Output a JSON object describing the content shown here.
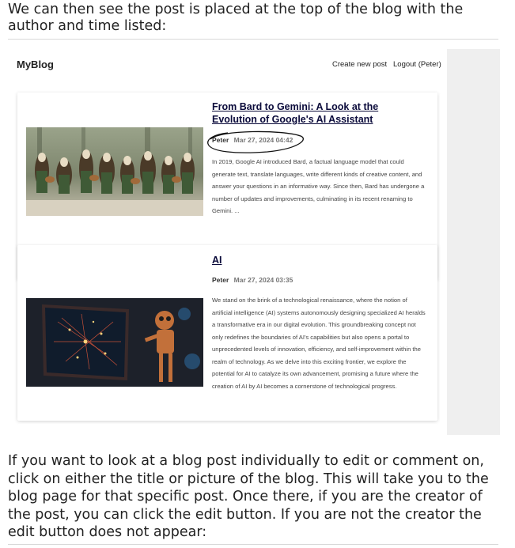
{
  "intro": "We can then see the post is placed at the top of the blog with the author and time listed:",
  "app": {
    "brand": "MyBlog",
    "nav": {
      "create": "Create new post",
      "logout": "Logout (Peter)"
    }
  },
  "posts": [
    {
      "title": "From Bard to Gemini: A Look at the Evolution of Google's AI Assistant",
      "author": "Peter",
      "time": "Mar 27, 2024 04:42",
      "excerpt": "In 2019, Google AI introduced Bard, a factual language model that could generate text, translate languages, write different kinds of creative content, and answer your questions in an informative way. Since then, Bard has undergone a number of updates and improvements, culminating in its recent renaming to Gemini. ..."
    },
    {
      "title": "AI",
      "author": "Peter",
      "time": "Mar 27, 2024 03:35",
      "excerpt": "We stand on the brink of a technological renaissance, where the notion of artificial intelligence (AI) systems autonomously designing specialized AI heralds a transformative era in our digital evolution. This groundbreaking concept not only redefines the boundaries of AI's capabilities but also opens a portal to unprecedented levels of innovation, efficiency, and self-improvement within the realm of technology. As we delve into this exciting frontier, we explore the potential for AI to catalyze its own advancement, promising a future where the creation of AI by AI becomes a cornerstone of technological progress."
    }
  ],
  "outro": "If you want to look at a blog post individually to edit or comment on, click on either the title or picture of the blog. This will take you to the blog page for that specific post. Once there, if you are the creator of the post, you can click the edit button. If you are not the creator the edit button does not appear:"
}
